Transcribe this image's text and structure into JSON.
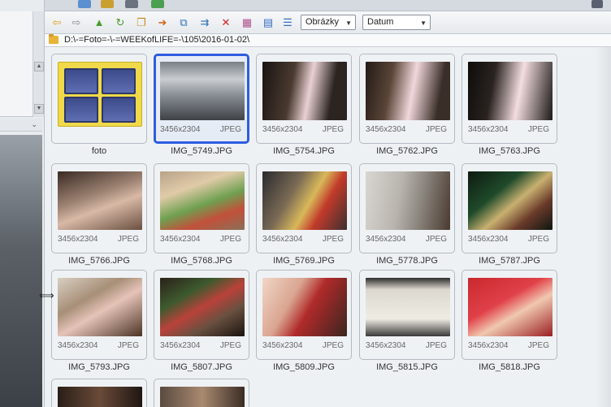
{
  "toolbar": {
    "view_select": "Obrázky",
    "sort_select": "Datum",
    "buttons": [
      {
        "name": "back-arrow-icon",
        "glyph": "⇦",
        "color": "#d9a21b"
      },
      {
        "name": "forward-arrow-icon",
        "glyph": "⇨",
        "color": "#8a9099"
      },
      {
        "name": "folder-up-icon",
        "glyph": "▲",
        "color": "#4a9b2f"
      },
      {
        "name": "folder-sync-icon",
        "glyph": "↻",
        "color": "#4a9b2f"
      },
      {
        "name": "folder-copy-icon",
        "glyph": "❐",
        "color": "#c78a1a"
      },
      {
        "name": "folder-move-icon",
        "glyph": "➜",
        "color": "#d46a1a"
      },
      {
        "name": "copy-icon",
        "glyph": "⧉",
        "color": "#2f6fb8"
      },
      {
        "name": "move-icon",
        "glyph": "⇉",
        "color": "#2f6fb8"
      },
      {
        "name": "delete-icon",
        "glyph": "✕",
        "color": "#d32020"
      },
      {
        "name": "thumbnail-view-icon",
        "glyph": "▦",
        "color": "#b05090"
      },
      {
        "name": "detail-view-icon",
        "glyph": "▤",
        "color": "#3a6ec0"
      },
      {
        "name": "list-view-icon",
        "glyph": "☰",
        "color": "#3a6ec0"
      }
    ]
  },
  "address": {
    "path": "D:\\-=Foto=-\\-=WEEKofLIFE=-\\105\\2016-01-02\\"
  },
  "items": [
    {
      "name": "foto",
      "type": "folder"
    },
    {
      "name": "IMG_5749.JPG",
      "dims": "3456x2304",
      "format": "JPEG",
      "selected": true
    },
    {
      "name": "IMG_5754.JPG",
      "dims": "3456x2304",
      "format": "JPEG"
    },
    {
      "name": "IMG_5762.JPG",
      "dims": "3456x2304",
      "format": "JPEG"
    },
    {
      "name": "IMG_5763.JPG",
      "dims": "3456x2304",
      "format": "JPEG"
    },
    {
      "name": "IMG_5766.JPG",
      "dims": "3456x2304",
      "format": "JPEG"
    },
    {
      "name": "IMG_5768.JPG",
      "dims": "3456x2304",
      "format": "JPEG"
    },
    {
      "name": "IMG_5769.JPG",
      "dims": "3456x2304",
      "format": "JPEG"
    },
    {
      "name": "IMG_5778.JPG",
      "dims": "3456x2304",
      "format": "JPEG"
    },
    {
      "name": "IMG_5787.JPG",
      "dims": "3456x2304",
      "format": "JPEG"
    },
    {
      "name": "IMG_5793.JPG",
      "dims": "3456x2304",
      "format": "JPEG"
    },
    {
      "name": "IMG_5807.JPG",
      "dims": "3456x2304",
      "format": "JPEG"
    },
    {
      "name": "IMG_5809.JPG",
      "dims": "3456x2304",
      "format": "JPEG"
    },
    {
      "name": "IMG_5815.JPG",
      "dims": "3456x2304",
      "format": "JPEG"
    },
    {
      "name": "IMG_5818.JPG",
      "dims": "3456x2304",
      "format": "JPEG"
    }
  ],
  "colors": {
    "selection": "#2e5de0",
    "folder_yellow": "#f0d94a"
  }
}
